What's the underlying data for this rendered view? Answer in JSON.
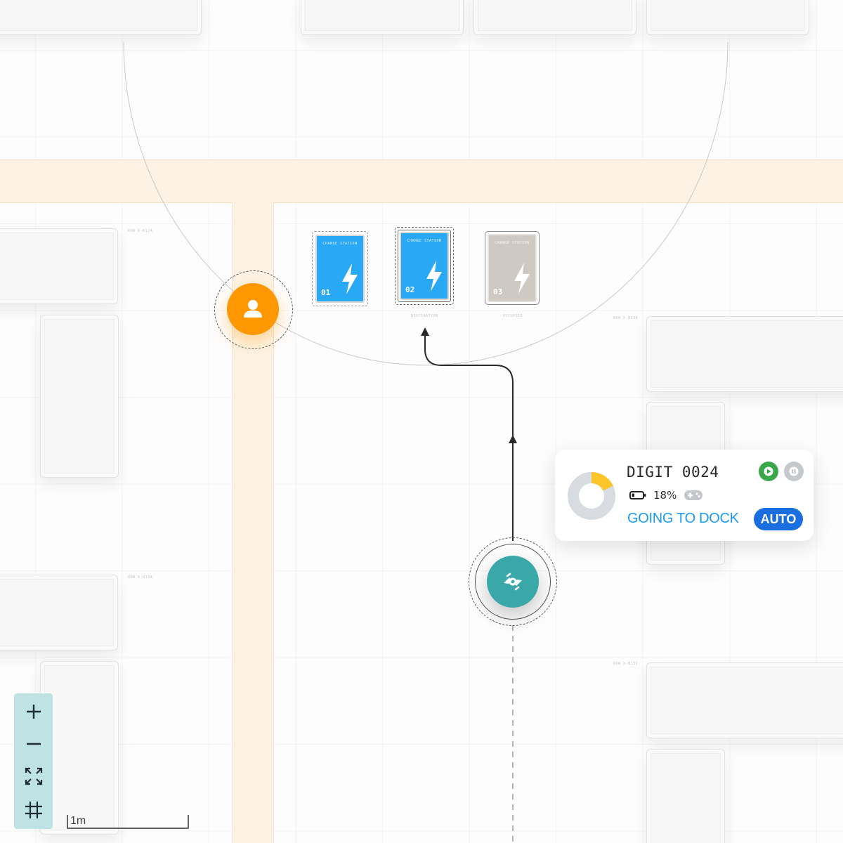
{
  "map": {
    "stations": [
      {
        "label": "CHANGE STATION",
        "number": "01",
        "color": "#29a8f5",
        "caption": ""
      },
      {
        "label": "CHANGE STATION",
        "number": "02",
        "color": "#29a8f5",
        "caption": "DESTINATION"
      },
      {
        "label": "CHANGE STATION",
        "number": "03",
        "color": "#cfc9c4",
        "caption": "OCCUPIED"
      }
    ],
    "zone_labels": [
      "ROW X-B12A",
      "ROW X-B13B",
      "ROW X-B13A",
      "ROW X-B13C"
    ]
  },
  "robot_card": {
    "name": "DIGIT 0024",
    "battery_percent": 18,
    "battery_text": "18%",
    "status": "GOING TO DOCK",
    "mode": "AUTO"
  },
  "colors": {
    "accent": "#1a9af0",
    "mode_badge": "#1a6fe0",
    "robot": "#3aa8a8",
    "person": "#ff9800",
    "corridor": "#fdf3e5",
    "zoom_panel": "#bfe3e3",
    "play": "#3aa84a"
  },
  "icons": {
    "person": "person-icon",
    "robot": "robot-icon",
    "zoom_in": "plus-icon",
    "zoom_out": "minus-icon",
    "fit": "expand-icon",
    "grid": "grid-icon",
    "battery": "battery-icon",
    "gamepad": "gamepad-icon",
    "play": "play-icon",
    "pause": "pause-icon",
    "bolt": "bolt-icon"
  },
  "scale_bar": {
    "label": "1m"
  }
}
